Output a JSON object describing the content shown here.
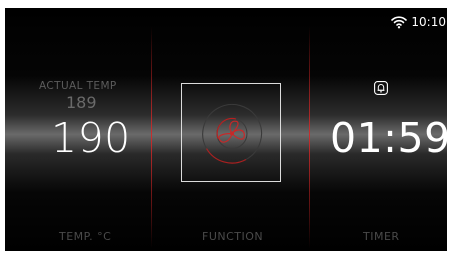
{
  "status_bar": {
    "wifi_icon": "wifi-icon",
    "time": "10:10"
  },
  "temperature": {
    "actual_label": "ACTUAL  TEMP",
    "actual_value": "189",
    "set_value": "190",
    "label": "TEMP. °C"
  },
  "function": {
    "icon": "fan-icon",
    "label": "FUNCTION"
  },
  "timer": {
    "icon": "bell-icon",
    "value": "01:59",
    "label": "TIMER"
  },
  "colors": {
    "background": "#000000",
    "text": "#ffffff",
    "accent_red": "#d02828",
    "muted_label": "#4a4a4a"
  }
}
